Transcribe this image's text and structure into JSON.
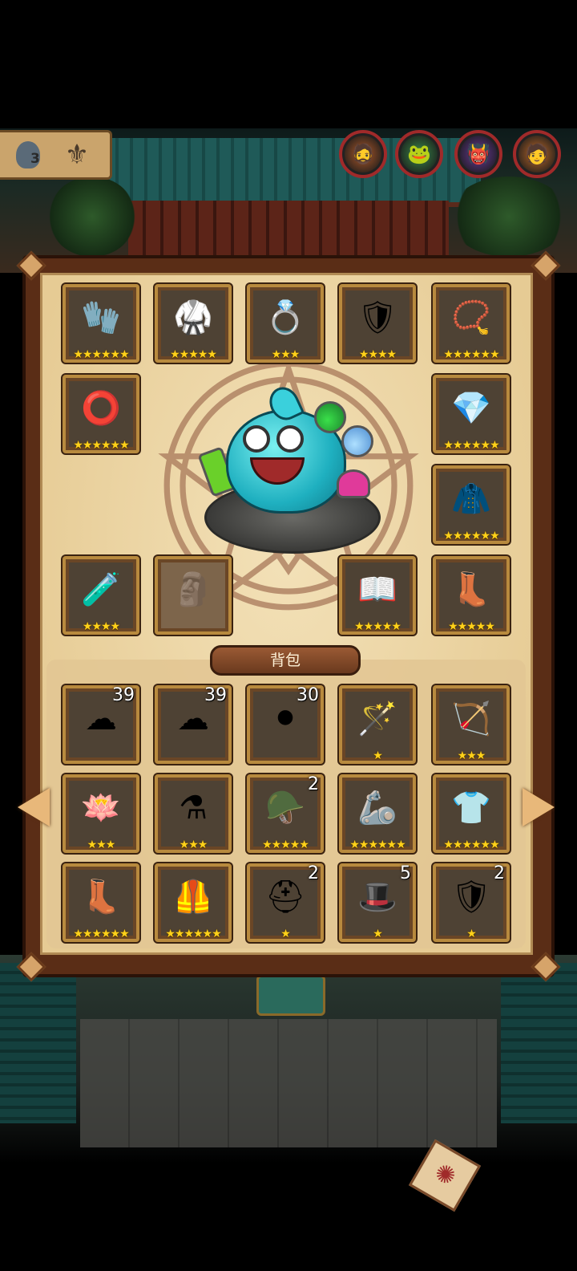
{
  "hud": {
    "player_count": "3",
    "player_icon": "player-avatar-icon",
    "totem_icon": "trophy-totem-icon",
    "heroes": [
      {
        "name": "hero-1",
        "icon": "🧔",
        "color": "#b05a2a"
      },
      {
        "name": "hero-2",
        "icon": "🐸",
        "color": "#3a8a4a"
      },
      {
        "name": "hero-3",
        "icon": "👹",
        "color": "#6a3a9a"
      },
      {
        "name": "hero-4",
        "icon": "🧑",
        "color": "#c06a2a"
      }
    ]
  },
  "equipment": [
    {
      "slot": "gloves",
      "icon": "🧤",
      "stars": "★★★★★★"
    },
    {
      "slot": "armor",
      "icon": "🥋",
      "stars": "★★★★★"
    },
    {
      "slot": "ring-gold",
      "icon": "💍",
      "stars": "★★★"
    },
    {
      "slot": "chest-plate",
      "icon": "🛡",
      "stars": "★★★★"
    },
    {
      "slot": "amulet",
      "icon": "📿",
      "stars": "★★★★★★"
    },
    {
      "slot": "belt",
      "icon": "⭕",
      "stars": "★★★★★★"
    },
    {
      "slot": "ring-blue",
      "icon": "💎",
      "stars": "★★★★★★"
    },
    {
      "slot": "cloak",
      "icon": "🧥",
      "stars": "★★★★★★"
    },
    {
      "slot": "alchemy-set",
      "icon": "🧪",
      "stars": "★★★★"
    },
    {
      "slot": "locked-slot",
      "icon": "🗿",
      "stars": ""
    },
    {
      "slot": "fire-book",
      "icon": "📖",
      "stars": "★★★★★"
    },
    {
      "slot": "boots",
      "icon": "👢",
      "stars": "★★★★★"
    }
  ],
  "bag_title": "背包",
  "bag": [
    {
      "item": "blue-cloud",
      "icon": "☁",
      "count": "39",
      "stars": ""
    },
    {
      "item": "dust-cloud",
      "icon": "☁",
      "count": "39",
      "stars": ""
    },
    {
      "item": "black-orb",
      "icon": "⚫",
      "count": "30",
      "stars": ""
    },
    {
      "item": "wand",
      "icon": "🪄",
      "count": "",
      "stars": "★"
    },
    {
      "item": "bow",
      "icon": "🏹",
      "count": "",
      "stars": "★★★"
    },
    {
      "item": "lotus",
      "icon": "🪷",
      "count": "",
      "stars": "★★★"
    },
    {
      "item": "potion",
      "icon": "⚗",
      "count": "",
      "stars": "★★★"
    },
    {
      "item": "aviator-helmet",
      "icon": "🪖",
      "count": "2",
      "stars": "★★★★★"
    },
    {
      "item": "purple-gauntlet",
      "icon": "🦾",
      "count": "",
      "stars": "★★★★★★"
    },
    {
      "item": "shirt-armor",
      "icon": "👕",
      "count": "",
      "stars": "★★★★★★"
    },
    {
      "item": "red-boots",
      "icon": "👢",
      "count": "",
      "stars": "★★★★★★"
    },
    {
      "item": "gold-armor",
      "icon": "🦺",
      "count": "",
      "stars": "★★★★★★"
    },
    {
      "item": "winged-helmet",
      "icon": "⛑",
      "count": "2",
      "stars": "★"
    },
    {
      "item": "horned-helmet",
      "icon": "🎩",
      "count": "5",
      "stars": "★"
    },
    {
      "item": "plate-armor",
      "icon": "🛡",
      "count": "2",
      "stars": "★"
    }
  ],
  "nav": {
    "prev_icon": "arrow-left-icon",
    "next_icon": "arrow-right-icon",
    "scroll_icon": "scroll-icon"
  }
}
